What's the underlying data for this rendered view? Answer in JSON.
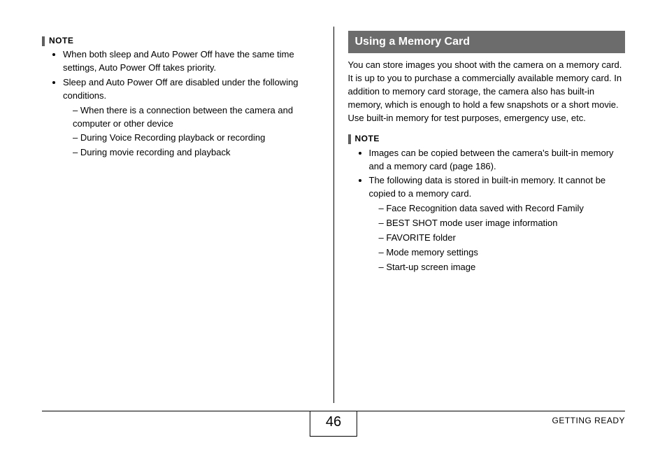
{
  "page_number": "46",
  "footer_section": "GETTING READY",
  "left": {
    "note_label": "NOTE",
    "bullets": [
      "When both sleep and Auto Power Off have the same time settings, Auto Power Off takes priority.",
      "Sleep and Auto Power Off are disabled under the following conditions."
    ],
    "sub_dashes": [
      "When there is a connection between the camera and computer or other device",
      "During Voice Recording playback or recording",
      "During movie recording and playback"
    ]
  },
  "right": {
    "section_title": "Using a Memory Card",
    "intro": "You can store images you shoot with the camera on a memory card. It is up to you to purchase a commercially available memory card. In addition to memory card storage, the camera also has built-in memory, which is enough to hold a few snapshots or a short movie. Use built-in memory for test purposes, emergency use, etc.",
    "note_label": "NOTE",
    "bullets": [
      "Images can be copied between the camera's built-in memory and a memory card (page 186).",
      "The following data is stored in built-in memory. It cannot be copied to a memory card."
    ],
    "sub_dashes": [
      "Face Recognition data saved with Record Family",
      "BEST SHOT mode user image information",
      "FAVORITE folder",
      "Mode memory settings",
      "Start-up screen image"
    ]
  }
}
